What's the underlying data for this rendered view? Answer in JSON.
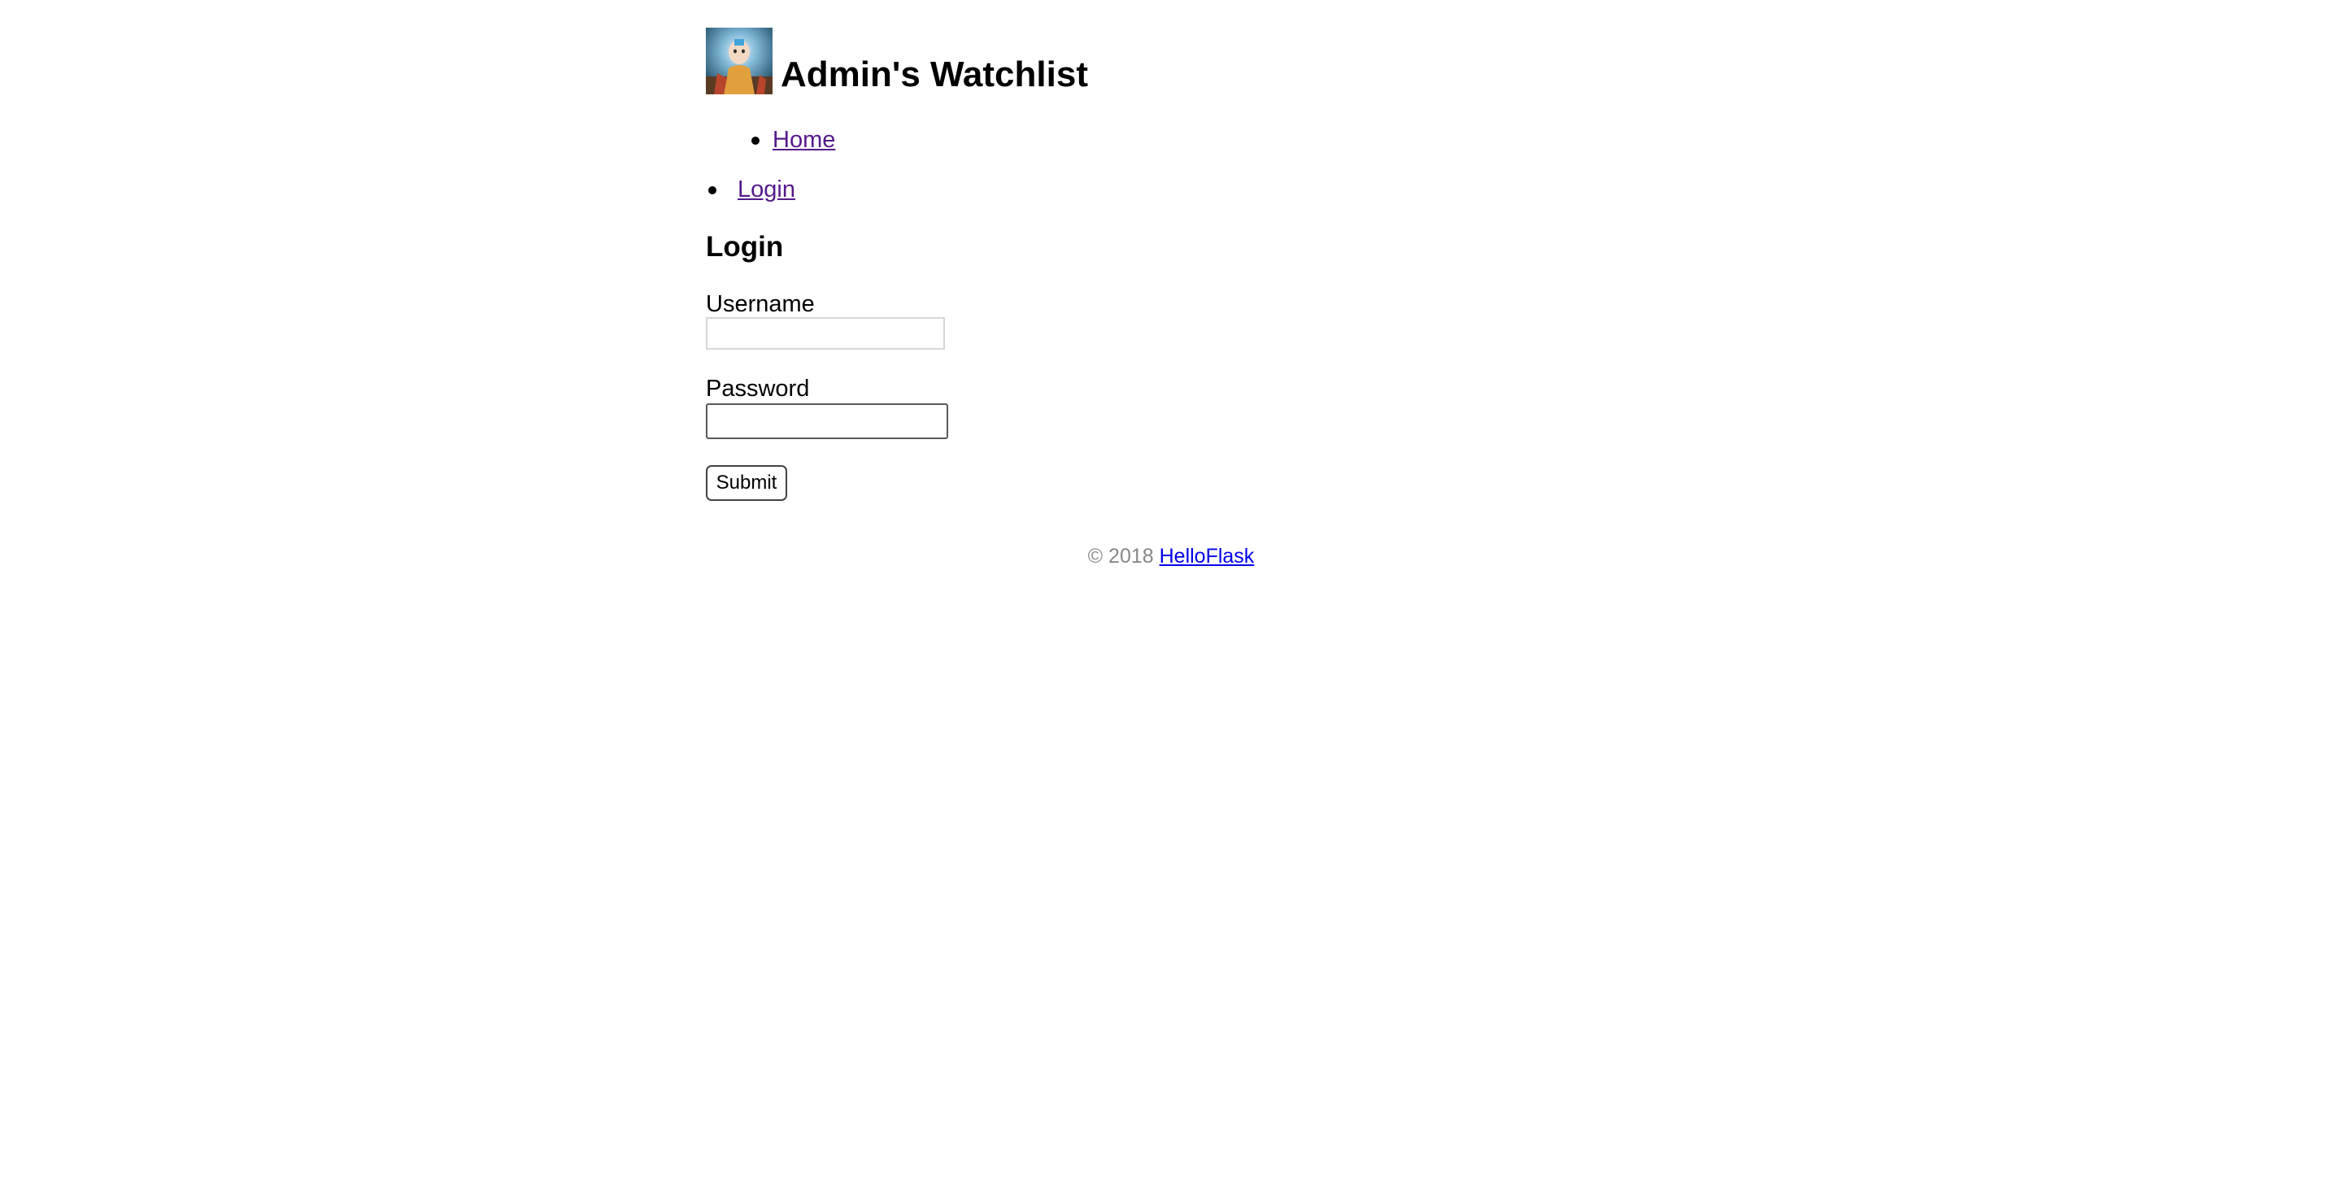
{
  "header": {
    "title": "Admin's Watchlist",
    "avatar_alt": "Avatar"
  },
  "nav": {
    "items": [
      {
        "label": "Home"
      },
      {
        "label": "Login"
      }
    ],
    "link_color": "#551a8b"
  },
  "login_form": {
    "title": "Login",
    "username_label": "Username",
    "username_value": "",
    "password_label": "Password",
    "password_value": "",
    "submit_label": "Submit"
  },
  "footer": {
    "copyright": "© 2018",
    "link_label": "HelloFlask",
    "text_color": "#888888",
    "link_color": "#0000ee"
  }
}
